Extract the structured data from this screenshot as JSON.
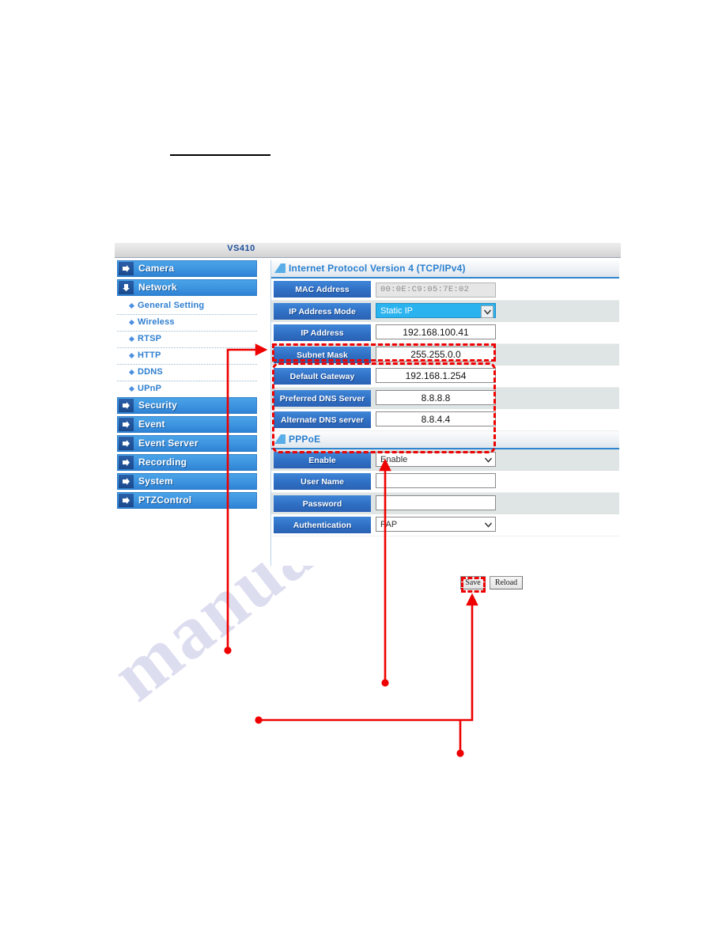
{
  "window": {
    "title": "VS410"
  },
  "sidebar": {
    "sections": [
      {
        "label": "Camera",
        "icon": "arrow-right-icon",
        "children": []
      },
      {
        "label": "Network",
        "icon": "arrow-down-icon",
        "children": [
          {
            "label": "General Setting"
          },
          {
            "label": "Wireless"
          },
          {
            "label": "RTSP"
          },
          {
            "label": "HTTP"
          },
          {
            "label": "DDNS"
          },
          {
            "label": "UPnP"
          }
        ]
      },
      {
        "label": "Security",
        "icon": "arrow-right-icon",
        "children": []
      },
      {
        "label": "Event",
        "icon": "arrow-right-icon",
        "children": []
      },
      {
        "label": "Event Server",
        "icon": "arrow-right-icon",
        "children": []
      },
      {
        "label": "Recording",
        "icon": "arrow-right-icon",
        "children": []
      },
      {
        "label": "System",
        "icon": "arrow-right-icon",
        "children": []
      },
      {
        "label": "PTZControl",
        "icon": "arrow-right-icon",
        "children": []
      }
    ]
  },
  "main": {
    "ipv4": {
      "heading": "Internet Protocol Version 4 (TCP/IPv4)",
      "fields": {
        "mac_address_label": "MAC Address",
        "mac_address_value": "00:0E:C9:05:7E:02",
        "ip_address_mode_label": "IP Address Mode",
        "ip_address_mode_value": "Static IP",
        "ip_address_label": "IP Address",
        "ip_address_value": "192.168.100.41",
        "subnet_mask_label": "Subnet Mask",
        "subnet_mask_value": "255.255.0.0",
        "default_gateway_label": "Default Gateway",
        "default_gateway_value": "192.168.1.254",
        "preferred_dns_label": "Preferred DNS Server",
        "preferred_dns_value": "8.8.8.8",
        "alternate_dns_label": "Alternate DNS server",
        "alternate_dns_value": "8.8.4.4"
      }
    },
    "pppoe": {
      "heading": "PPPoE",
      "fields": {
        "enable_label": "Enable",
        "enable_value": "Enable",
        "user_name_label": "User Name",
        "user_name_value": "",
        "password_label": "Password",
        "password_value": "",
        "authentication_label": "Authentication",
        "authentication_value": "PAP"
      }
    },
    "buttons": {
      "save": "Save",
      "reload": "Reload"
    }
  },
  "watermark": {
    "text": "manualshive.com"
  },
  "annotation": {
    "color": "#ee0000",
    "highlights": [
      "ip-address-row",
      "network-settings-group",
      "save-button"
    ]
  }
}
